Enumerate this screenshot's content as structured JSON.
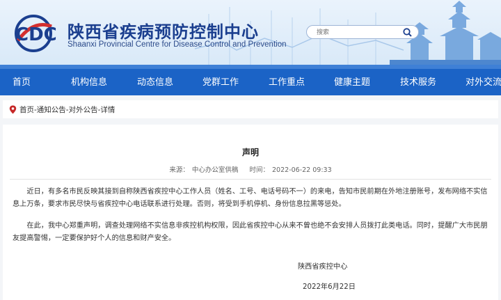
{
  "header": {
    "title_cn": "陕西省疾病预防控制中心",
    "title_en": "Shaanxi Provincial Centre for Disease Control and Prevention",
    "logo_text": "CDC",
    "search_placeholder": "搜索"
  },
  "nav": {
    "items": [
      "首页",
      "机构信息",
      "动态信息",
      "党群工作",
      "工作重点",
      "健康主题",
      "技术服务",
      "对外交流"
    ]
  },
  "breadcrumb": "首页-通知公告-对外公告-详情",
  "article": {
    "title": "声明",
    "source_label": "来源：",
    "source": "中心办公室供稿",
    "time_label": "时间：",
    "time": "2022-06-22 09:33",
    "paragraphs": [
      "近日，有多名市民反映其接到自称陕西省疾控中心工作人员（姓名、工号、电话号码不一）的来电，告知市民前期在外地注册账号，发布网络不实信息上万条，要求市民尽快与省疾控中心电话联系进行处理。否则，将受到手机停机、身份信息拉黑等惩处。",
      "在此，我中心郑重声明，调查处理网络不实信息非疾控机构权限，因此省疾控中心从来不曾也绝不会安排人员拨打此类电话。同时，提醒广大市民朋友提高警惕，一定要保护好个人的信息和财产安全。"
    ],
    "signature": "陕西省疾控中心",
    "date": "2022年6月22日"
  },
  "colors": {
    "brand_blue": "#1b63c6",
    "title_blue": "#1b3f8f",
    "logo_red": "#d32f2f"
  }
}
